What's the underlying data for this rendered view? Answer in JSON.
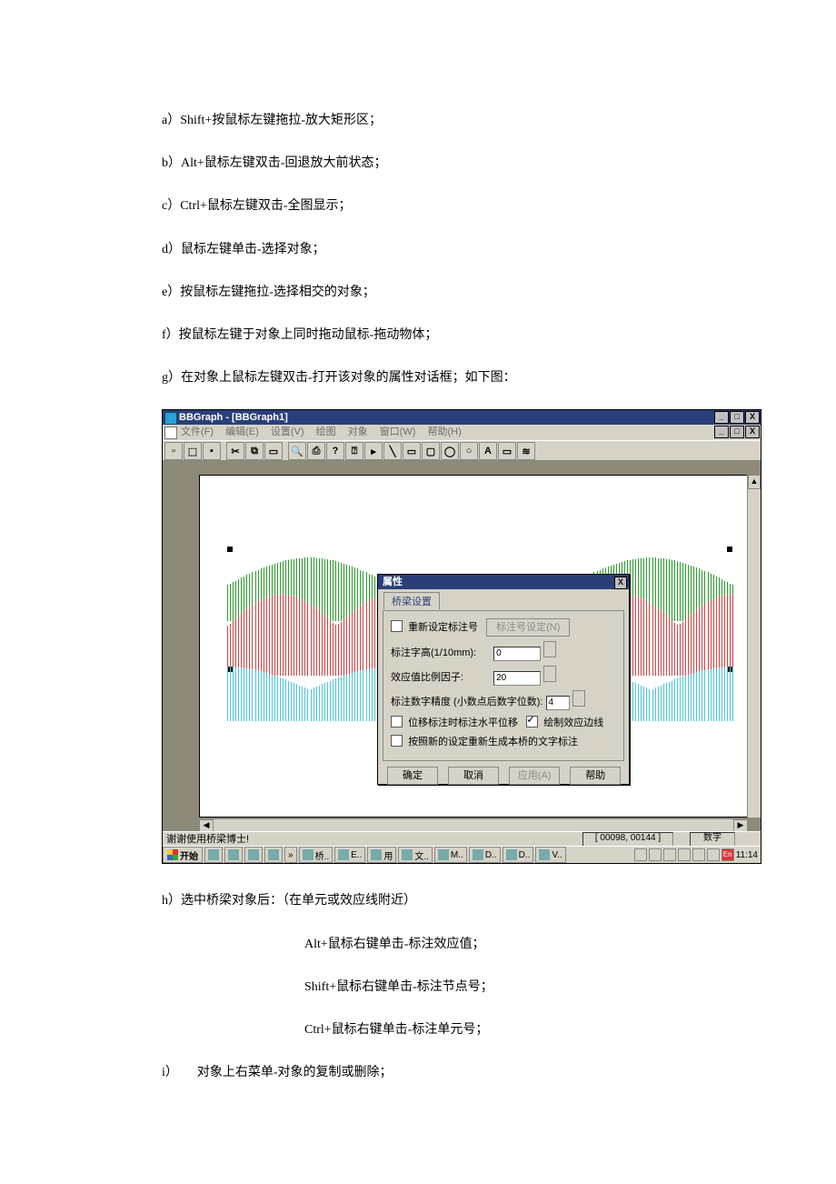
{
  "body": {
    "a": "a）Shift+按鼠标左键拖拉-放大矩形区；",
    "b": "b）Alt+鼠标左键双击-回退放大前状态；",
    "c": "c）Ctrl+鼠标左键双击-全图显示；",
    "d": "d）鼠标左键单击-选择对象；",
    "e": "e）按鼠标左键拖拉-选择相交的对象；",
    "f": "f）按鼠标左键于对象上同时拖动鼠标-拖动物体；",
    "g": "g）在对象上鼠标左键双击-打开该对象的属性对话框；如下图：",
    "h": "h）选中桥梁对象后：（在单元或效应线附近）",
    "h1": "Alt+鼠标右键单击-标注效应值；",
    "h2": "Shift+鼠标右键单击-标注节点号；",
    "h3": "Ctrl+鼠标右键单击-标注单元号；",
    "i": "i）　　对象上右菜单-对象的复制或删除；"
  },
  "app": {
    "title": "BBGraph - [BBGraph1]",
    "menus": [
      "文件(F)",
      "编辑(E)",
      "设置(V)",
      "绘图",
      "对象",
      "窗口(W)",
      "帮助(H)"
    ],
    "status_text": "谢谢使用桥梁博士!",
    "coord": "[ 00098, 00144 ]",
    "mode": "数字",
    "start": "开始",
    "clock": "11:14",
    "tasks": [
      "桥..",
      "E..",
      "用",
      "文..",
      "M..",
      "D..",
      "D..",
      "V.."
    ]
  },
  "dialog": {
    "title": "属性",
    "tab": "桥梁设置",
    "chk_relabel": "重新设定标注号",
    "btn_relabel": "标注号设定(N)",
    "lbl_height": "标注字高(1/10mm):",
    "val_height": "0",
    "lbl_factor": "效应值比例因子:",
    "val_factor": "20",
    "lbl_prec": "标注数字精度 (小数点后数字位数):",
    "val_prec": "4",
    "chk_horiz": "位移标注时标注水平位移",
    "chk_drawline": "绘制效应边线",
    "chk_regen": "按照新的设定重新生成本桥的文字标注",
    "ok": "确定",
    "cancel": "取消",
    "apply": "应用(A)",
    "help": "帮助"
  }
}
